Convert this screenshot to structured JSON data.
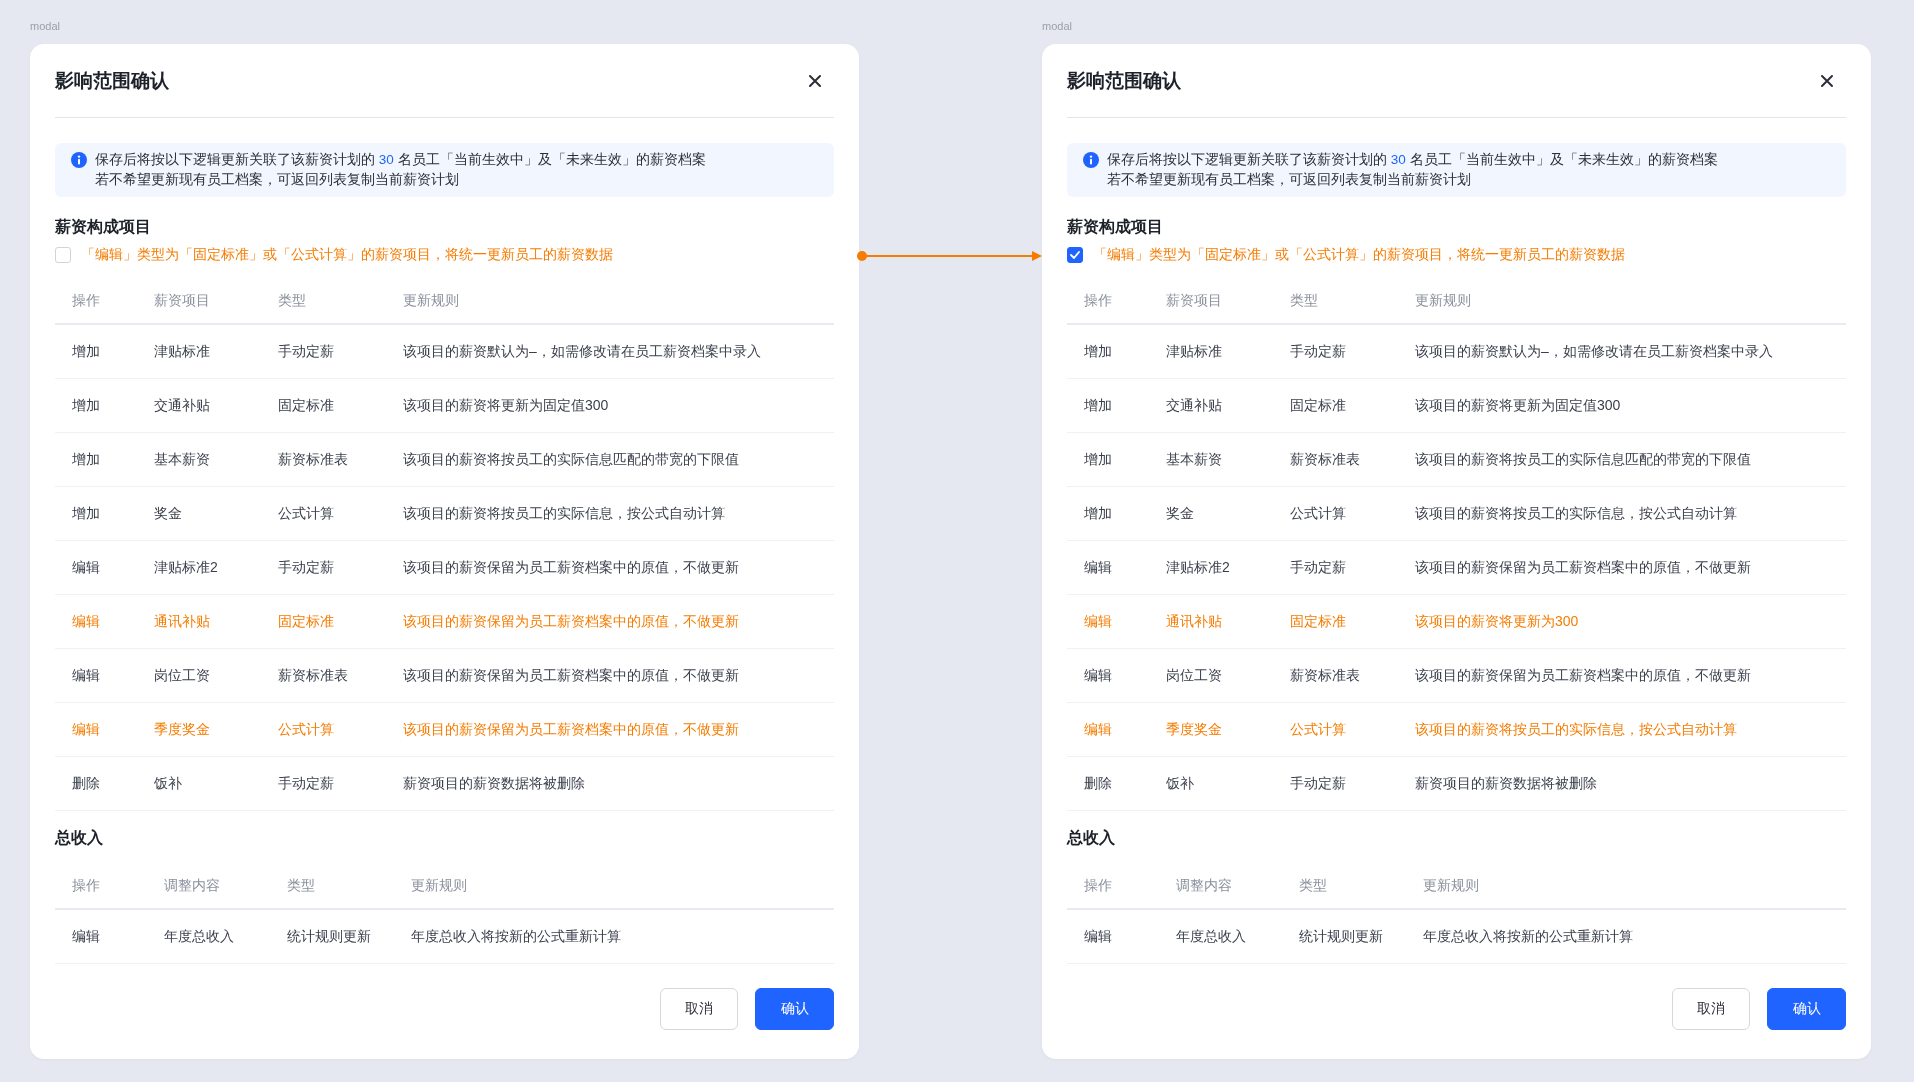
{
  "modals": [
    {
      "label": "modal",
      "title": "影响范围确认",
      "alert": {
        "text_before": "保存后将按以下逻辑更新关联了该薪资计划的 ",
        "count": "30",
        "text_after": " 名员工「当前生效中」及「未来生效」的薪资档案",
        "note": "若不希望更新现有员工档案，可返回列表复制当前薪资计划"
      },
      "components": {
        "heading": "薪资构成项目",
        "checkbox": {
          "label": "「编辑」类型为「固定标准」或「公式计算」的薪资项目，将统一更新员工的薪资数据",
          "checked": false
        },
        "columns": [
          "操作",
          "薪资项目",
          "类型",
          "更新规则"
        ],
        "rows": [
          {
            "cells": [
              "增加",
              "津贴标准",
              "手动定薪",
              "该项目的薪资默认为–，如需修改请在员工薪资档案中录入"
            ],
            "highlighted": false
          },
          {
            "cells": [
              "增加",
              "交通补贴",
              "固定标准",
              "该项目的薪资将更新为固定值300"
            ],
            "highlighted": false
          },
          {
            "cells": [
              "增加",
              "基本薪资",
              "薪资标准表",
              "该项目的薪资将按员工的实际信息匹配的带宽的下限值"
            ],
            "highlighted": false
          },
          {
            "cells": [
              "增加",
              "奖金",
              "公式计算",
              "该项目的薪资将按员工的实际信息，按公式自动计算"
            ],
            "highlighted": false
          },
          {
            "cells": [
              "编辑",
              "津贴标准2",
              "手动定薪",
              "该项目的薪资保留为员工薪资档案中的原值，不做更新"
            ],
            "highlighted": false
          },
          {
            "cells": [
              "编辑",
              "通讯补贴",
              "固定标准",
              "该项目的薪资保留为员工薪资档案中的原值，不做更新"
            ],
            "highlighted": true
          },
          {
            "cells": [
              "编辑",
              "岗位工资",
              "薪资标准表",
              "该项目的薪资保留为员工薪资档案中的原值，不做更新"
            ],
            "highlighted": false
          },
          {
            "cells": [
              "编辑",
              "季度奖金",
              "公式计算",
              "该项目的薪资保留为员工薪资档案中的原值，不做更新"
            ],
            "highlighted": true
          },
          {
            "cells": [
              "删除",
              "饭补",
              "手动定薪",
              "薪资项目的薪资数据将被删除"
            ],
            "highlighted": false
          }
        ]
      },
      "total": {
        "heading": "总收入",
        "columns": [
          "操作",
          "调整内容",
          "类型",
          "更新规则"
        ],
        "rows": [
          {
            "cells": [
              "编辑",
              "年度总收入",
              "统计规则更新",
              "年度总收入将按新的公式重新计算"
            ],
            "highlighted": false
          }
        ]
      },
      "buttons": [
        {
          "label": "取消",
          "kind": "secondary"
        },
        {
          "label": "确认",
          "kind": "primary"
        }
      ]
    },
    {
      "label": "modal",
      "title": "影响范围确认",
      "alert": {
        "text_before": "保存后将按以下逻辑更新关联了该薪资计划的 ",
        "count": "30",
        "text_after": " 名员工「当前生效中」及「未来生效」的薪资档案",
        "note": "若不希望更新现有员工档案，可返回列表复制当前薪资计划"
      },
      "components": {
        "heading": "薪资构成项目",
        "checkbox": {
          "label": "「编辑」类型为「固定标准」或「公式计算」的薪资项目，将统一更新员工的薪资数据",
          "checked": true
        },
        "columns": [
          "操作",
          "薪资项目",
          "类型",
          "更新规则"
        ],
        "rows": [
          {
            "cells": [
              "增加",
              "津贴标准",
              "手动定薪",
              "该项目的薪资默认为–，如需修改请在员工薪资档案中录入"
            ],
            "highlighted": false
          },
          {
            "cells": [
              "增加",
              "交通补贴",
              "固定标准",
              "该项目的薪资将更新为固定值300"
            ],
            "highlighted": false
          },
          {
            "cells": [
              "增加",
              "基本薪资",
              "薪资标准表",
              "该项目的薪资将按员工的实际信息匹配的带宽的下限值"
            ],
            "highlighted": false
          },
          {
            "cells": [
              "增加",
              "奖金",
              "公式计算",
              "该项目的薪资将按员工的实际信息，按公式自动计算"
            ],
            "highlighted": false
          },
          {
            "cells": [
              "编辑",
              "津贴标准2",
              "手动定薪",
              "该项目的薪资保留为员工薪资档案中的原值，不做更新"
            ],
            "highlighted": false
          },
          {
            "cells": [
              "编辑",
              "通讯补贴",
              "固定标准",
              "该项目的薪资将更新为300"
            ],
            "highlighted": true
          },
          {
            "cells": [
              "编辑",
              "岗位工资",
              "薪资标准表",
              "该项目的薪资保留为员工薪资档案中的原值，不做更新"
            ],
            "highlighted": false
          },
          {
            "cells": [
              "编辑",
              "季度奖金",
              "公式计算",
              "该项目的薪资将按员工的实际信息，按公式自动计算"
            ],
            "highlighted": true
          },
          {
            "cells": [
              "删除",
              "饭补",
              "手动定薪",
              "薪资项目的薪资数据将被删除"
            ],
            "highlighted": false
          }
        ]
      },
      "total": {
        "heading": "总收入",
        "columns": [
          "操作",
          "调整内容",
          "类型",
          "更新规则"
        ],
        "rows": [
          {
            "cells": [
              "编辑",
              "年度总收入",
              "统计规则更新",
              "年度总收入将按新的公式重新计算"
            ],
            "highlighted": false
          }
        ]
      },
      "buttons": [
        {
          "label": "取消",
          "kind": "secondary"
        },
        {
          "label": "确认",
          "kind": "primary"
        }
      ]
    }
  ]
}
